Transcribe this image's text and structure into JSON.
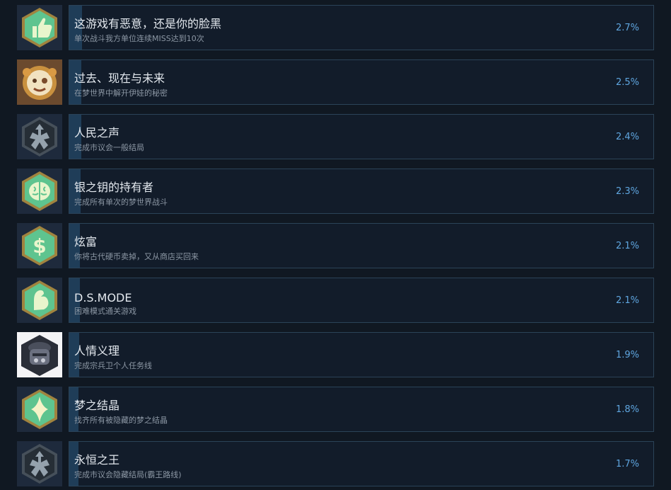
{
  "achievements": [
    {
      "name": "这游戏有恶意，还是你的脸黑",
      "description": "单次战斗我方单位连续MISS达到10次",
      "percent_text": "2.7%",
      "percent": 2.7,
      "icon": "thumbs-up-icon",
      "icon_color": "#5ec48f"
    },
    {
      "name": "过去、现在与未来",
      "description": "在梦世界中解开伊娃的秘密",
      "percent_text": "2.5%",
      "percent": 2.5,
      "icon": "clown-portrait-icon",
      "icon_color": "#c9913f"
    },
    {
      "name": "人民之声",
      "description": "完成市议会一般结局",
      "percent_text": "2.4%",
      "percent": 2.4,
      "icon": "crest-emblem-icon",
      "icon_color": "#5a6670"
    },
    {
      "name": "银之钥的持有者",
      "description": "完成所有单次的梦世界战斗",
      "percent_text": "2.3%",
      "percent": 2.3,
      "icon": "brain-icon",
      "icon_color": "#5ec48f"
    },
    {
      "name": "炫富",
      "description": "你将古代硬币卖掉，又从商店买回来",
      "percent_text": "2.1%",
      "percent": 2.1,
      "icon": "dollar-icon",
      "icon_color": "#5ec48f"
    },
    {
      "name": "D.S.MODE",
      "description": "困难模式通关游戏",
      "percent_text": "2.1%",
      "percent": 2.1,
      "icon": "flexed-arm-icon",
      "icon_color": "#5ec48f"
    },
    {
      "name": "人情义理",
      "description": "完成宗兵卫个人任务线",
      "percent_text": "1.9%",
      "percent": 1.9,
      "icon": "armored-warrior-icon",
      "icon_color": "#3a3f4a"
    },
    {
      "name": "梦之结晶",
      "description": "找齐所有被隐藏的梦之结晶",
      "percent_text": "1.8%",
      "percent": 1.8,
      "icon": "crystal-icon",
      "icon_color": "#5ec48f"
    },
    {
      "name": "永恒之王",
      "description": "完成市议会隐藏结局(霸王路线)",
      "percent_text": "1.7%",
      "percent": 1.7,
      "icon": "crest-emblem-icon",
      "icon_color": "#5a6670"
    }
  ]
}
